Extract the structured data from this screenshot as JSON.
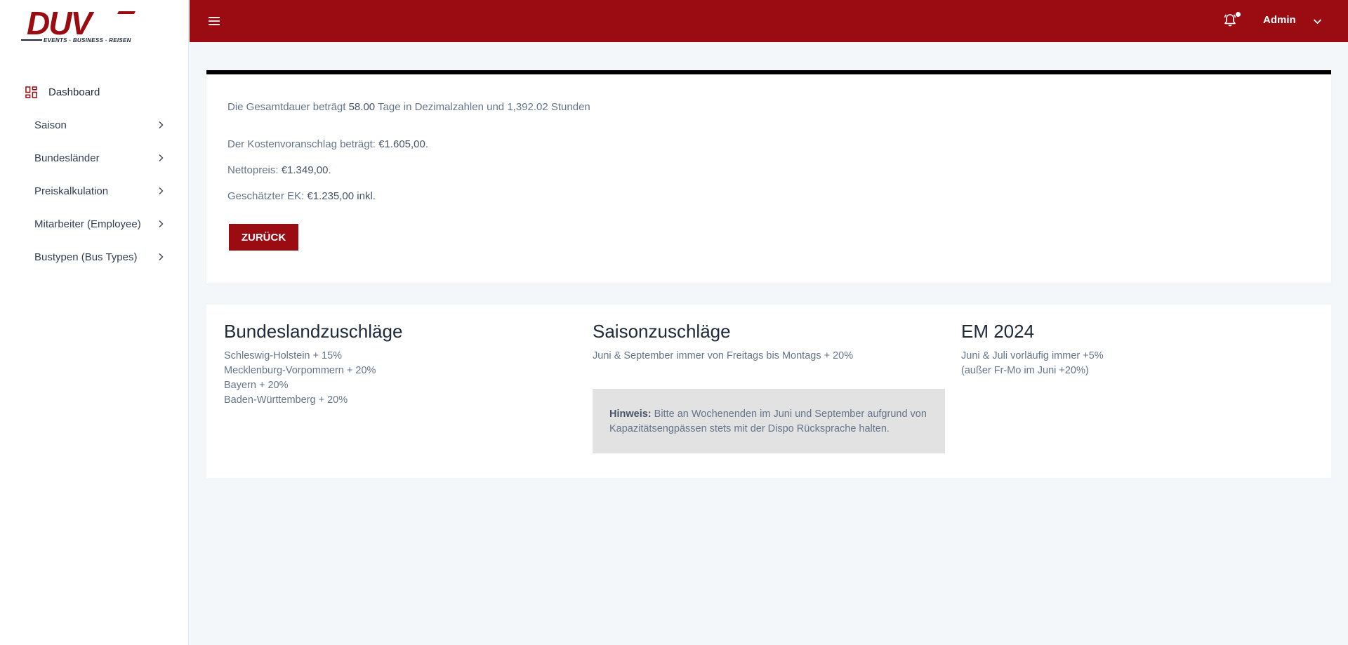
{
  "logo": {
    "text": "DUV",
    "tagline": "EVENTS · BUSINESS · REISEN"
  },
  "sidebar": {
    "items": [
      {
        "label": "Dashboard",
        "icon": "grid-icon"
      },
      {
        "label": "Saison",
        "icon": "chevron-right-icon"
      },
      {
        "label": "Bundesländer",
        "icon": "chevron-right-icon"
      },
      {
        "label": "Preiskalkulation",
        "icon": "chevron-right-icon"
      },
      {
        "label": "Mitarbeiter (Employee)",
        "icon": "chevron-right-icon"
      },
      {
        "label": "Bustypen (Bus Types)",
        "icon": "chevron-right-icon"
      }
    ]
  },
  "header": {
    "user": "Admin",
    "icons": [
      "menu-icon",
      "bell-icon",
      "chevron-down-icon"
    ]
  },
  "result": {
    "duration_prefix": "Die Gesamtdauer beträgt ",
    "duration_days": "58.00",
    "duration_suffix": " Tage in Dezimalzahlen und 1,392.02 Stunden",
    "estimate_prefix": "Der Kostenvoranschlag beträgt: ",
    "estimate_value": "€1.605,00",
    "estimate_suffix": ".",
    "net_prefix": "Nettopreis: ",
    "net_value": "€1.349,00",
    "net_suffix": ".",
    "ek_prefix": "Geschätzter EK: ",
    "ek_value": "€1.235,00 inkl.",
    "back_button": "ZURÜCK"
  },
  "surcharges": {
    "states": {
      "title": "Bundeslandzuschläge",
      "lines": [
        "Schleswig-Holstein + 15%",
        "Mecklenburg-Vorpommern + 20%",
        "Bayern + 20%",
        "Baden-Württemberg + 20%"
      ]
    },
    "season": {
      "title": "Saisonzuschläge",
      "line": "Juni & September immer von Freitags bis Montags + 20%",
      "note_label": "Hinweis:",
      "note_text": " Bitte an Wochenenden im Juni und September aufgrund von Kapazitätsengpässen stets mit der Dispo Rücksprache halten."
    },
    "em": {
      "title": "EM 2024",
      "lines": [
        "Juni & Juli vorläufig immer +5%",
        "(außer Fr-Mo im Juni +20%)"
      ]
    }
  },
  "colors": {
    "brand": "#9b0c12",
    "background": "#f4f7fa",
    "note_bg": "#e2e2e2"
  }
}
